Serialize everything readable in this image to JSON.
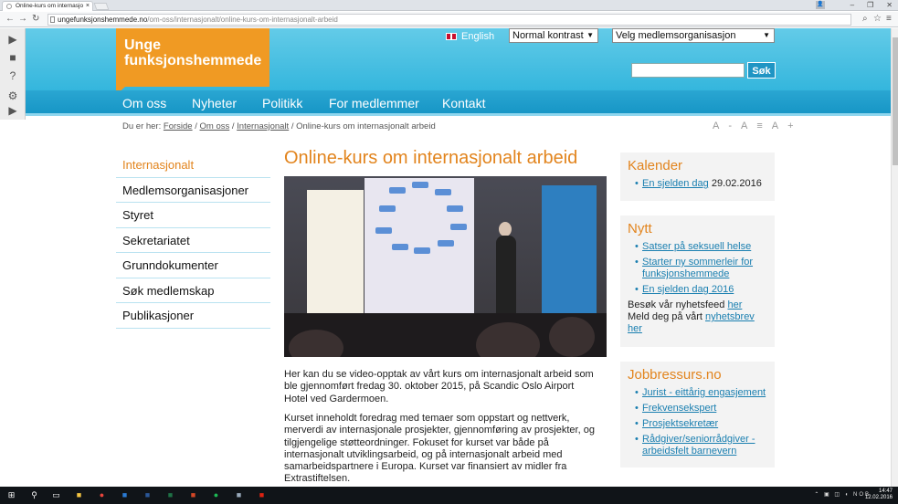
{
  "browser": {
    "tab_title": "Online-kurs om internasjo",
    "url_host": "ungefunksjonshemmede.no",
    "url_path": "/om-oss/internasjonalt/online-kurs-om-internasjonalt-arbeid"
  },
  "header": {
    "logo_line1": "Unge",
    "logo_line2": "funksjonshemmede",
    "english": "English",
    "contrast_select": "Normal kontrast",
    "org_select": "Velg medlemsorganisasjon",
    "search_button": "Søk"
  },
  "nav": [
    "Om oss",
    "Nyheter",
    "Politikk",
    "For medlemmer",
    "Kontakt"
  ],
  "breadcrumb": {
    "prefix": "Du er her:",
    "items": [
      "Forside",
      "Om oss",
      "Internasjonalt"
    ],
    "current": "Online-kurs om internasjonalt arbeid"
  },
  "font_tools": [
    "A-",
    "A≡",
    "A+"
  ],
  "leftmenu": [
    "Internasjonalt",
    "Medlemsorganisasjoner",
    "Styret",
    "Sekretariatet",
    "Grunndokumenter",
    "Søk medlemskap",
    "Publikasjoner"
  ],
  "article": {
    "title": "Online-kurs om internasjonalt arbeid",
    "para1": "Her kan du se video-opptak av vårt kurs om internasjonalt arbeid som ble gjennomført fredag 30. oktober 2015, på Scandic Oslo Airport Hotel ved Gardermoen.",
    "para2": "Kurset inneholdt foredrag med temaer som oppstart og nettverk, merverdi av internasjonale prosjekter, gjennomføring av prosjekter, og tilgjengelige støtteordninger. Fokuset for kurset var både på internasjonalt utviklingsarbeid, og på internasjonalt arbeid med samarbeidspartnere i Europa. Kurset var finansiert av midler fra Extrastiftelsen."
  },
  "kalender": {
    "title": "Kalender",
    "item_link": "En sjelden dag",
    "item_date": "29.02.2016"
  },
  "nytt": {
    "title": "Nytt",
    "items": [
      "Satser på seksuell helse",
      "Starter ny sommerleir for funksjonshemmede",
      "En sjelden dag 2016"
    ],
    "feed_text": "Besøk vår nyhetsfeed",
    "feed_link": "her",
    "newsletter_text": "Meld deg på vårt",
    "newsletter_link": "nyhetsbrev her"
  },
  "jobb": {
    "title": "Jobbressurs.no",
    "items": [
      "Jurist - eittårig engasjement",
      "Frekvensekspert",
      "Prosjektsekretær",
      "Rådgiver/seniorrådgiver - arbeidsfelt barnevern"
    ]
  },
  "taskbar": {
    "lang": "NOB",
    "time": "14:47",
    "date": "12.02.2016"
  }
}
